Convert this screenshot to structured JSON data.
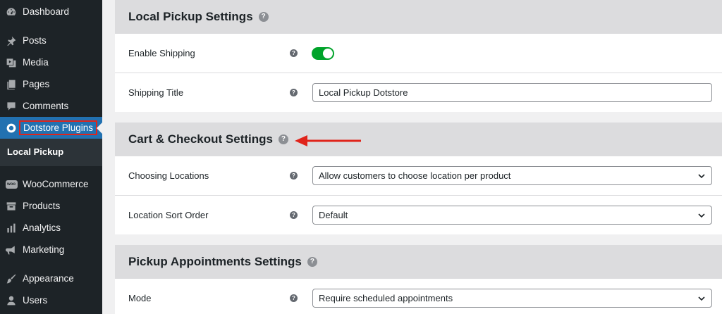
{
  "sidebar": {
    "items": [
      {
        "label": "Dashboard",
        "icon": "dashboard-icon"
      },
      {
        "label": "Posts",
        "icon": "pin-icon"
      },
      {
        "label": "Media",
        "icon": "media-icon"
      },
      {
        "label": "Pages",
        "icon": "pages-icon"
      },
      {
        "label": "Comments",
        "icon": "comment-icon"
      },
      {
        "label": "Dotstore Plugins",
        "icon": "dotstore-icon"
      },
      {
        "label": "WooCommerce",
        "icon": "woo-icon"
      },
      {
        "label": "Products",
        "icon": "archive-icon"
      },
      {
        "label": "Analytics",
        "icon": "chart-icon"
      },
      {
        "label": "Marketing",
        "icon": "megaphone-icon"
      },
      {
        "label": "Appearance",
        "icon": "brush-icon"
      },
      {
        "label": "Users",
        "icon": "user-icon"
      }
    ],
    "submenu": {
      "label": "Local Pickup"
    },
    "woo_badge": "woo"
  },
  "sections": {
    "local_pickup": {
      "title": "Local Pickup Settings",
      "rows": {
        "enable_shipping": {
          "label": "Enable Shipping",
          "enabled": true
        },
        "shipping_title": {
          "label": "Shipping Title",
          "value": "Local Pickup Dotstore"
        }
      }
    },
    "cart_checkout": {
      "title": "Cart & Checkout Settings",
      "rows": {
        "choosing_locations": {
          "label": "Choosing Locations",
          "value": "Allow customers to choose location per product"
        },
        "location_sort": {
          "label": "Location Sort Order",
          "value": "Default"
        }
      }
    },
    "pickup_appointments": {
      "title": "Pickup Appointments Settings",
      "rows": {
        "mode": {
          "label": "Mode",
          "value": "Require scheduled appointments"
        }
      }
    }
  },
  "help_glyph": "?",
  "colors": {
    "accent": "#2271b1",
    "toggle_on": "#00a32a",
    "annotation": "#e0241b",
    "sidebar": "#1d2327"
  }
}
